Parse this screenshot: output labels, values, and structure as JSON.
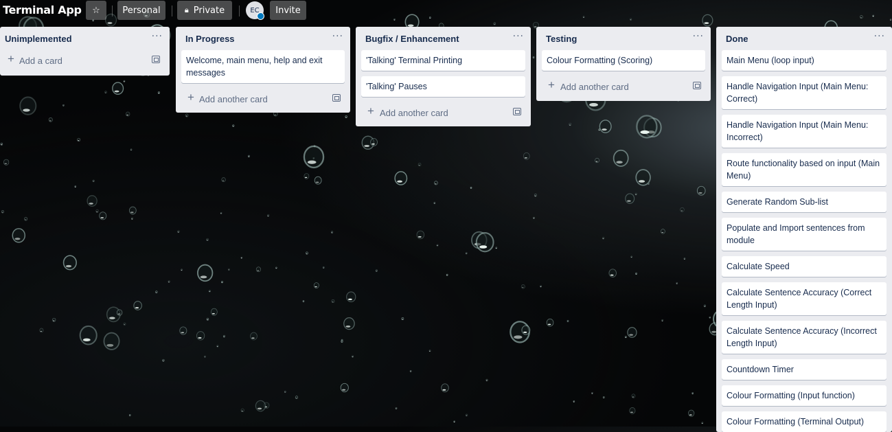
{
  "board": {
    "title": "Terminal App",
    "personal_label": "Personal",
    "private_label": "Private",
    "avatar_initials": "EC",
    "invite_label": "Invite"
  },
  "lists": [
    {
      "name": "Unimplemented",
      "menu": "···",
      "cards": [],
      "add_label": "Add a card"
    },
    {
      "name": "In Progress",
      "menu": "···",
      "cards": [
        "Welcome, main menu, help and exit messages"
      ],
      "add_label": "Add another card"
    },
    {
      "name": "Bugfix / Enhancement",
      "menu": "···",
      "cards": [
        "'Talking' Terminal Printing",
        "'Talking' Pauses"
      ],
      "add_label": "Add another card"
    },
    {
      "name": "Testing",
      "menu": "···",
      "cards": [
        "Colour Formatting (Scoring)"
      ],
      "add_label": "Add another card"
    },
    {
      "name": "Done",
      "menu": "···",
      "cards": [
        "Main Menu (loop input)",
        "Handle Navigation Input (Main Menu: Correct)",
        "Handle Navigation Input (Main Menu: Incorrect)",
        "Route functionality based on input (Main Menu)",
        "Generate Random Sub-list",
        "Populate and Import sentences from module",
        "Calculate Speed",
        "Calculate Sentence Accuracy (Correct Length Input)",
        "Calculate Sentence Accuracy (Incorrect Length Input)",
        "Countdown Timer",
        "Colour Formatting (Input function)",
        "Colour Formatting (Terminal Output)"
      ],
      "add_label": ""
    }
  ]
}
